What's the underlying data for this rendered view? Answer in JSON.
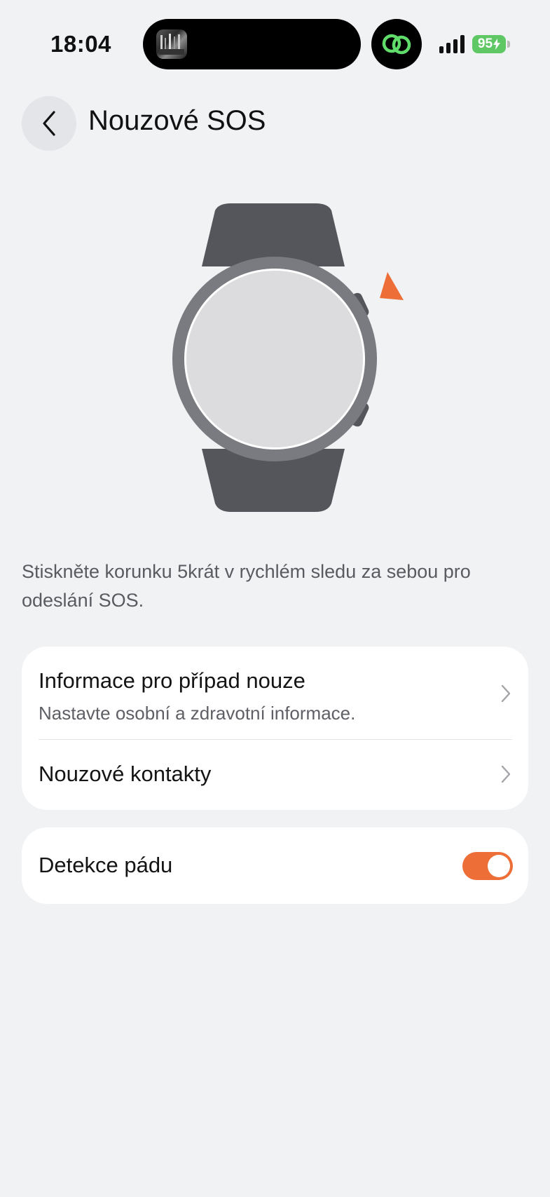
{
  "status_bar": {
    "time": "18:04",
    "battery": "95",
    "icons": [
      "signal-icon",
      "battery-charging-icon",
      "link-app-icon"
    ]
  },
  "header": {
    "title": "Nouzové SOS",
    "back_icon": "chevron-left-icon"
  },
  "illustration": {
    "name": "smartwatch-crown-press",
    "accent_color": "#ee6e37"
  },
  "description": "Stiskněte korunku 5krát v rychlém sledu za sebou pro odeslání SOS.",
  "emergency_card": {
    "info": {
      "title": "Informace pro případ nouze",
      "subtitle": "Nastavte osobní a zdravotní informace."
    },
    "contacts": {
      "title": "Nouzové kontakty"
    }
  },
  "fall_detection": {
    "title": "Detekce pádu",
    "enabled": true,
    "toggle_color": "#ee6e37"
  },
  "colors": {
    "background": "#f1f2f4",
    "card": "#ffffff",
    "accent": "#ee6e37",
    "battery": "#5fc865"
  }
}
